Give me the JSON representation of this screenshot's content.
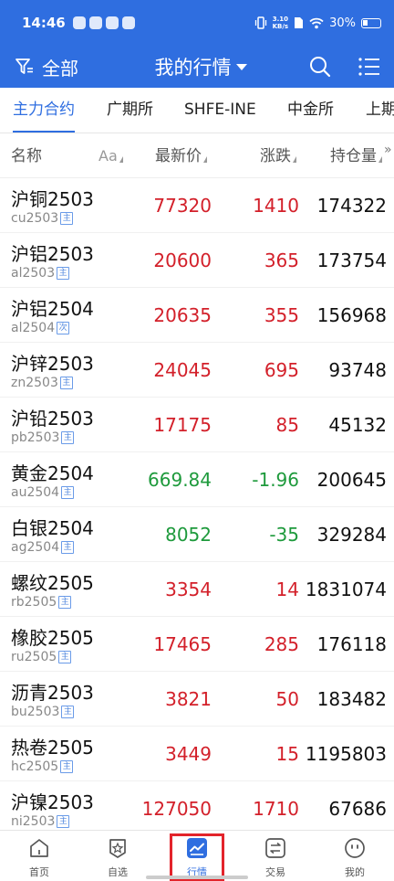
{
  "status_bar": {
    "time": "14:46",
    "speed_value": "3.10",
    "speed_unit": "KB/s",
    "battery": "30%"
  },
  "header": {
    "filter_label": "全部",
    "title": "我的行情"
  },
  "tabs": [
    {
      "label": "主力合约",
      "active": true
    },
    {
      "label": "广期所",
      "active": false
    },
    {
      "label": "SHFE-INE",
      "active": false
    },
    {
      "label": "中金所",
      "active": false
    },
    {
      "label": "上期",
      "active": false
    }
  ],
  "columns": {
    "name": "名称",
    "aa": "Aa",
    "price": "最新价",
    "change": "涨跌",
    "open_interest": "持仓量"
  },
  "rows": [
    {
      "name": "沪铜2503",
      "code": "cu2503",
      "tag": "主",
      "price": "77320",
      "change": "1410",
      "open_interest": "174322",
      "trend": "up"
    },
    {
      "name": "沪铝2503",
      "code": "al2503",
      "tag": "主",
      "price": "20600",
      "change": "365",
      "open_interest": "173754",
      "trend": "up"
    },
    {
      "name": "沪铝2504",
      "code": "al2504",
      "tag": "次",
      "price": "20635",
      "change": "355",
      "open_interest": "156968",
      "trend": "up"
    },
    {
      "name": "沪锌2503",
      "code": "zn2503",
      "tag": "主",
      "price": "24045",
      "change": "695",
      "open_interest": "93748",
      "trend": "up"
    },
    {
      "name": "沪铅2503",
      "code": "pb2503",
      "tag": "主",
      "price": "17175",
      "change": "85",
      "open_interest": "45132",
      "trend": "up"
    },
    {
      "name": "黄金2504",
      "code": "au2504",
      "tag": "主",
      "price": "669.84",
      "change": "-1.96",
      "open_interest": "200645",
      "trend": "down"
    },
    {
      "name": "白银2504",
      "code": "ag2504",
      "tag": "主",
      "price": "8052",
      "change": "-35",
      "open_interest": "329284",
      "trend": "down"
    },
    {
      "name": "螺纹2505",
      "code": "rb2505",
      "tag": "主",
      "price": "3354",
      "change": "14",
      "open_interest": "1831074",
      "trend": "up"
    },
    {
      "name": "橡胶2505",
      "code": "ru2505",
      "tag": "主",
      "price": "17465",
      "change": "285",
      "open_interest": "176118",
      "trend": "up"
    },
    {
      "name": "沥青2503",
      "code": "bu2503",
      "tag": "主",
      "price": "3821",
      "change": "50",
      "open_interest": "183482",
      "trend": "up"
    },
    {
      "name": "热卷2505",
      "code": "hc2505",
      "tag": "主",
      "price": "3449",
      "change": "15",
      "open_interest": "1195803",
      "trend": "up"
    },
    {
      "name": "沪镍2503",
      "code": "ni2503",
      "tag": "主",
      "price": "127050",
      "change": "1710",
      "open_interest": "67686",
      "trend": "up"
    }
  ],
  "bottom_nav": [
    {
      "label": "首页",
      "icon": "home-icon",
      "active": false
    },
    {
      "label": "自选",
      "icon": "star-shield-icon",
      "active": false
    },
    {
      "label": "行情",
      "icon": "chart-icon",
      "active": true
    },
    {
      "label": "交易",
      "icon": "exchange-icon",
      "active": false
    },
    {
      "label": "我的",
      "icon": "profile-icon",
      "active": false
    }
  ],
  "colors": {
    "brand": "#2f6ee0",
    "up": "#d3202a",
    "down": "#1e9a3c",
    "highlight_box": "#e3242b"
  }
}
